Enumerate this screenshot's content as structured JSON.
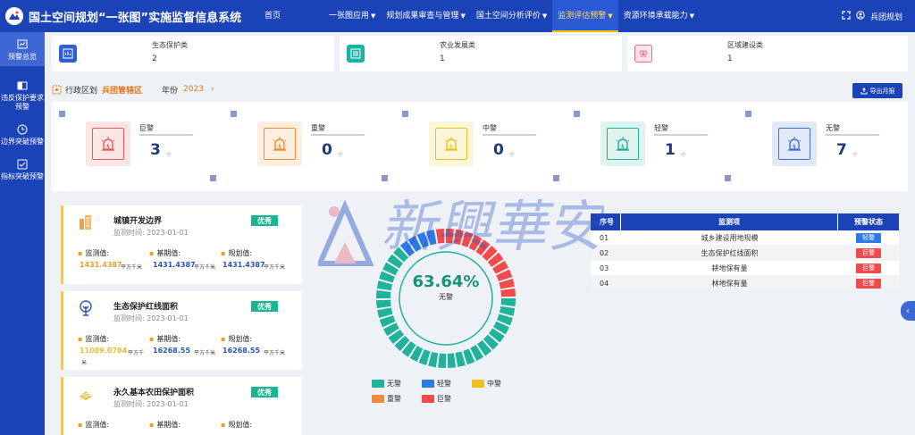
{
  "app": {
    "title": "国土空间规划“一张图”实施监督信息系统"
  },
  "nav": [
    {
      "label": "首页",
      "caret": false,
      "active": false
    },
    {
      "label": "一张图应用",
      "caret": true,
      "active": false
    },
    {
      "label": "规划成果审查与管理",
      "caret": true,
      "active": false
    },
    {
      "label": "国土空间分析评价",
      "caret": true,
      "active": false
    },
    {
      "label": "监测评估预警",
      "caret": true,
      "active": true
    },
    {
      "label": "资源环境承载能力",
      "caret": true,
      "active": false
    }
  ],
  "user": {
    "name": "兵团规划"
  },
  "sidebar": [
    {
      "label": "预警总览",
      "icon": "overview-icon",
      "active": true
    },
    {
      "label": "违反保护要求预警",
      "icon": "protect-icon",
      "active": false
    },
    {
      "label": "边界突破预警",
      "icon": "boundary-icon",
      "active": false
    },
    {
      "label": "指标突破预警",
      "icon": "indicator-icon",
      "active": false
    }
  ],
  "categories": [
    {
      "name": "生态保护类",
      "value": "2",
      "icon": "ecology-icon",
      "color": "#2f5fd0"
    },
    {
      "name": "农业发展类",
      "value": "1",
      "icon": "agriculture-icon",
      "color": "#19b3a6"
    },
    {
      "name": "区域建设类",
      "value": "1",
      "icon": "construction-icon",
      "color": "#e86a8a"
    }
  ],
  "filter": {
    "region_label": "行政区划",
    "region_value": "兵团管辖区",
    "year_label": "年份",
    "year_value": "2023",
    "export_label": "导出月报"
  },
  "levels": [
    {
      "name": "巨警",
      "count": "3",
      "unit": "个",
      "color": "#e85a5a",
      "bg": "#fbe5e5"
    },
    {
      "name": "重警",
      "count": "0",
      "unit": "个",
      "color": "#ef8a3a",
      "bg": "#fdeede"
    },
    {
      "name": "中警",
      "count": "0",
      "unit": "个",
      "color": "#e8c21c",
      "bg": "#fbf5d9"
    },
    {
      "name": "轻警",
      "count": "1",
      "unit": "个",
      "color": "#22ad93",
      "bg": "#dff3ef"
    },
    {
      "name": "无警",
      "count": "7",
      "unit": "个",
      "color": "#3d6fd8",
      "bg": "#e1e9f8"
    }
  ],
  "indicators": [
    {
      "title": "城镇开发边界",
      "time_label": "监测时间:",
      "time": "2023-01-01",
      "badge": "优秀",
      "icon": "building-icon",
      "monitor_label": "监测值:",
      "monitor_value": "1431.4387",
      "base_label": "基期值:",
      "base_value": "1431.4387",
      "plan_label": "规划值:",
      "plan_value": "1431.4387",
      "unit": "平方千米"
    },
    {
      "title": "生态保护红线面积",
      "time_label": "监测时间:",
      "time": "2023-01-01",
      "badge": "优秀",
      "icon": "tree-icon",
      "monitor_label": "监测值:",
      "monitor_value": "11089.0704",
      "base_label": "基期值:",
      "base_value": "16268.55",
      "plan_label": "规划值:",
      "plan_value": "16268.55",
      "unit": "平方千米",
      "unit_split": [
        "平方千",
        "米"
      ]
    },
    {
      "title": "永久基本农田保护面积",
      "time_label": "监测时间:",
      "time": "2023-01-01",
      "badge": "优秀",
      "icon": "farmland-icon",
      "monitor_label": "监测值:",
      "base_label": "基期值:",
      "plan_label": "规划值:"
    }
  ],
  "gauge": {
    "percent": "63.64%",
    "label": "无警",
    "fraction": 0.6364
  },
  "legend": [
    {
      "label": "无警",
      "color": "#20b29b"
    },
    {
      "label": "轻警",
      "color": "#2c7be5"
    },
    {
      "label": "中警",
      "color": "#f0c020"
    },
    {
      "label": "重警",
      "color": "#f08a3c"
    },
    {
      "label": "巨警",
      "color": "#ef4b4b"
    }
  ],
  "table": {
    "headers": [
      "序号",
      "监测项",
      "预警状态"
    ],
    "rows": [
      {
        "no": "01",
        "item": "城乡建设用地规模",
        "status": "轻警",
        "color": "#2c7be5"
      },
      {
        "no": "02",
        "item": "生态保护红线面积",
        "status": "巨警",
        "color": "#ef4b4b"
      },
      {
        "no": "03",
        "item": "耕地保有量",
        "status": "巨警",
        "color": "#ef4b4b"
      },
      {
        "no": "04",
        "item": "林地保有量",
        "status": "巨警",
        "color": "#ef4b4b"
      }
    ]
  },
  "watermark": {
    "text": "新興華安"
  }
}
